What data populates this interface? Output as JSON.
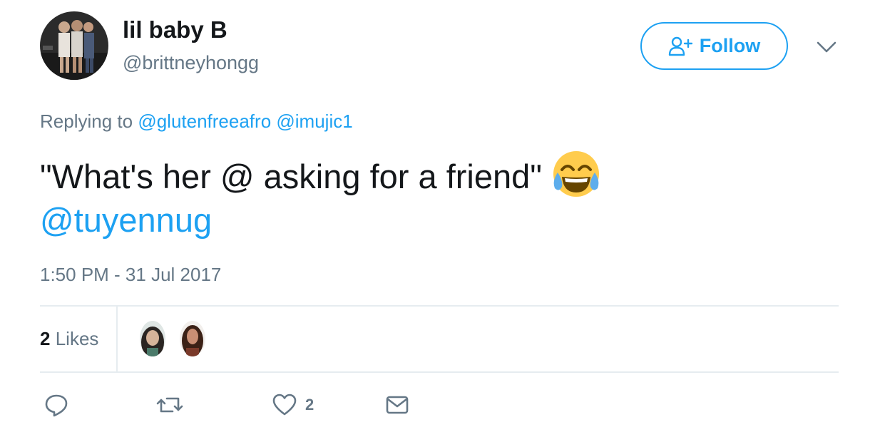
{
  "tweet": {
    "display_name": "lil baby B",
    "handle": "@brittneyhongg",
    "follow_label": "Follow",
    "replying_prefix": "Replying to",
    "reply_mentions": [
      "@glutenfreeafro",
      "@imujic1"
    ],
    "text_line1": "\"What's her @ asking for a friend\"",
    "emoji": "face-with-tears-of-joy",
    "text_mention": "@tuyennug",
    "timestamp": "1:50 PM - 31 Jul 2017"
  },
  "stats": {
    "likes_count": "2",
    "likes_label": "Likes"
  },
  "actions": {
    "like_count": "2"
  },
  "icons": {
    "follow": "follow-user-plus-icon",
    "caret": "chevron-down-icon",
    "reply": "reply-bubble-icon",
    "retweet": "retweet-icon",
    "like": "heart-icon",
    "dm": "envelope-icon"
  },
  "colors": {
    "accent": "#1da1f2",
    "text": "#14171a",
    "muted": "#657786",
    "divider": "#e6ecf0"
  }
}
